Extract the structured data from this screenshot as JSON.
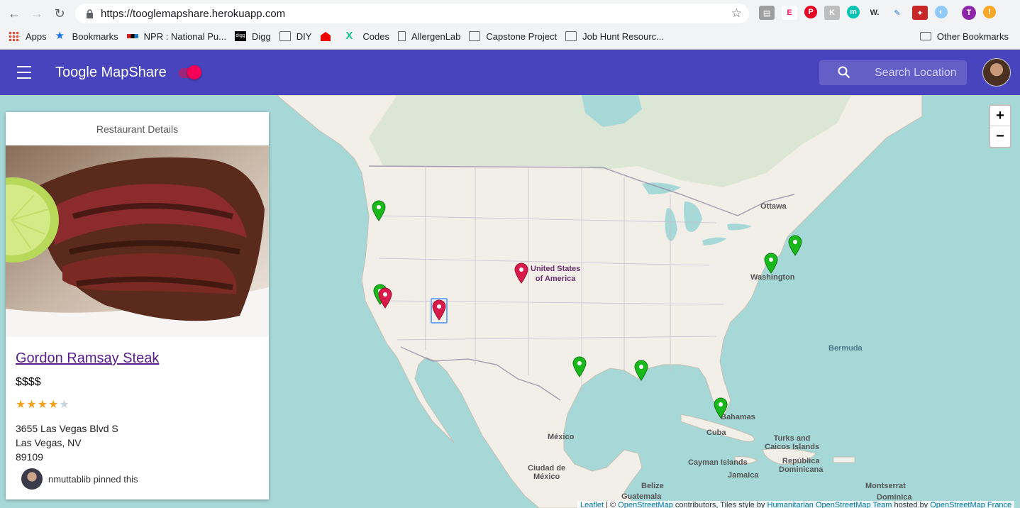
{
  "browser": {
    "url": "https://tooglemapshare.herokuapp.com",
    "bookmarks": [
      {
        "label": "Apps",
        "icon": "apps-grid-icon"
      },
      {
        "label": "Bookmarks",
        "icon": "star-icon"
      },
      {
        "label": "NPR : National Pu...",
        "icon": "npr-icon"
      },
      {
        "label": "Digg",
        "icon": "digg-icon"
      },
      {
        "label": "DIY",
        "icon": "folder-icon"
      },
      {
        "label": "",
        "icon": "red-house-icon"
      },
      {
        "label": "Codes",
        "icon": "codes-icon"
      },
      {
        "label": "AllergenLab",
        "icon": "page-icon"
      },
      {
        "label": "Capstone Project",
        "icon": "folder-icon"
      },
      {
        "label": "Job Hunt Resourc...",
        "icon": "folder-icon"
      }
    ],
    "other_bookmarks": "Other Bookmarks",
    "profile_initial": "T"
  },
  "appbar": {
    "title": "Toogle MapShare",
    "search_placeholder": "Search Location"
  },
  "map": {
    "zoom_in": "+",
    "zoom_out": "−",
    "labels": {
      "usa": "United States\nof America",
      "ottawa": "Ottawa",
      "washington": "Washington",
      "bermuda": "Bermuda",
      "mexico": "México",
      "ciudad": "Ciudad de\nMéxico",
      "bahamas": "Bahamas",
      "cuba": "Cuba",
      "turks": "Turks and\nCaicos Islands",
      "cayman": "Cayman Islands",
      "republica": "República\nDominicana",
      "jamaica": "Jamaica",
      "belize": "Belize",
      "guatemala": "Guatemala",
      "montserrat": "Montserrat",
      "dominica": "Dominica"
    },
    "attribution": {
      "leaflet": "Leaflet",
      "sep": " | © ",
      "osm": "OpenStreetMap",
      "contrib": " contributors, Tiles style by ",
      "hot": "Humanitarian OpenStreetMap Team",
      "hosted": " hosted by ",
      "osmfr": "OpenStreetMap France"
    }
  },
  "card": {
    "header": "Restaurant Details",
    "name": "Gordon Ramsay Steak",
    "price": "$$$$",
    "rating": 4,
    "rating_max": 5,
    "address_line1": "3655 Las Vegas Blvd S",
    "address_line2": "Las Vegas, NV",
    "address_line3": "89109",
    "pinned_by": "nmuttablib pinned this"
  },
  "colors": {
    "appbar": "#4844be",
    "pin_green": "#19b91c",
    "pin_red": "#d81b4a",
    "water": "#a6d8d7",
    "land": "#f2efe9"
  }
}
